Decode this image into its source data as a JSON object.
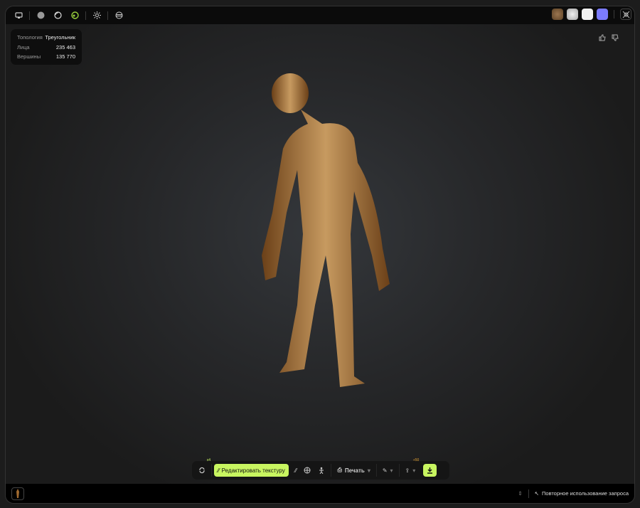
{
  "info": {
    "rows": [
      {
        "label": "Топология",
        "value": "Треугольник"
      },
      {
        "label": "Лица",
        "value": "235 463"
      },
      {
        "label": "Вершины",
        "value": "135 770"
      }
    ]
  },
  "swatches": [
    "#7a5a3a",
    "#cfcfcf",
    "#f2f2f2",
    "#7b7bff"
  ],
  "toolbar": {
    "regen_badge": "x4",
    "edit_texture": "Редактировать текстуру",
    "print": "Печать",
    "export_badge": "+50"
  },
  "bottom": {
    "reuse": "Повторное использование запроса"
  },
  "colors": {
    "accent": "#c8f560"
  }
}
